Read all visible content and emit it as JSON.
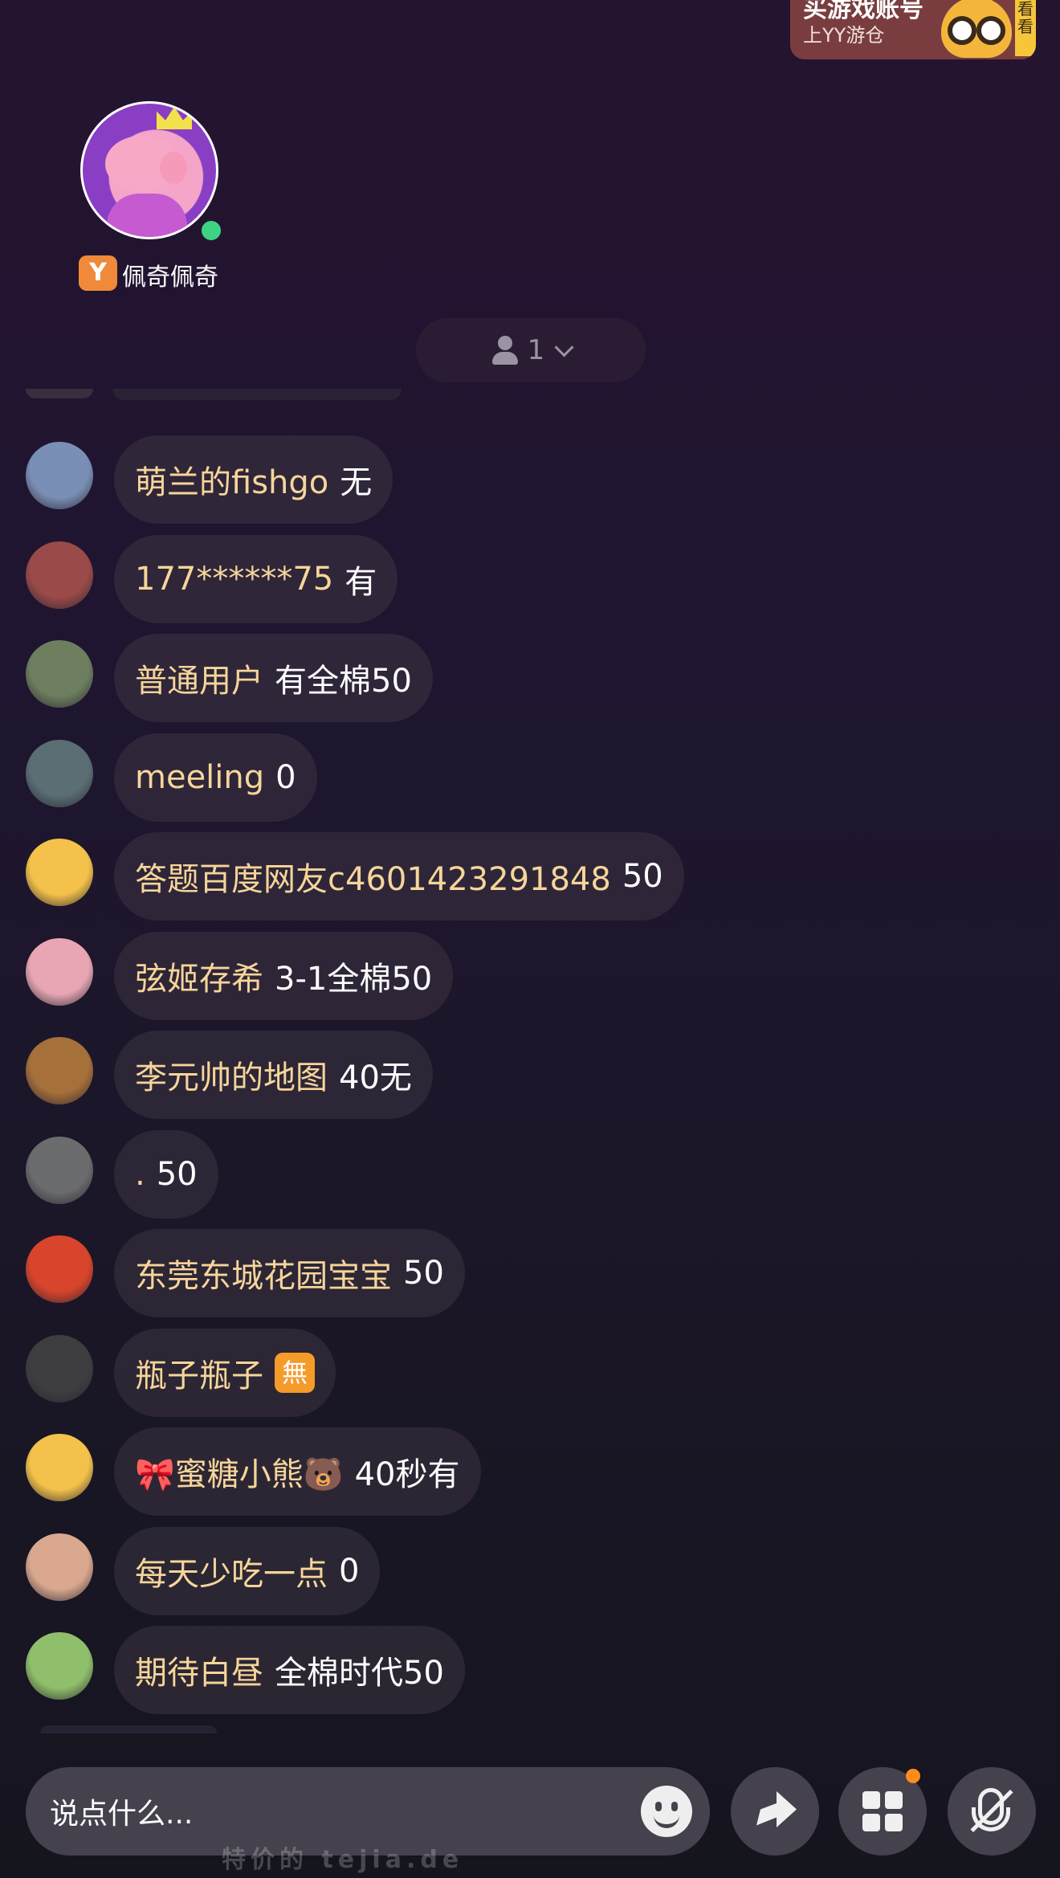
{
  "banner": {
    "line1": "买游戏账号",
    "line2": "上YY游仓",
    "tag": "看看"
  },
  "host": {
    "name": "佩奇佩奇",
    "badge": "Y"
  },
  "viewers": {
    "count": "1"
  },
  "chat": [
    {
      "user": "萌兰的fishgo",
      "msg": "无",
      "avatar_color": "#7a8fb5"
    },
    {
      "user": "177******75",
      "msg": "有",
      "avatar_color": "#9a4a48"
    },
    {
      "user": "普通用户",
      "msg": "有全棉50",
      "avatar_color": "#6d7f5e"
    },
    {
      "user": "meeling",
      "msg": "0",
      "avatar_color": "#5a6e73"
    },
    {
      "user": "答题百度网友c4601423291848",
      "msg": "50",
      "avatar_color": "#f4c24a"
    },
    {
      "user": "弦姬存希",
      "msg": "3-1全棉50",
      "avatar_color": "#e8a6b4"
    },
    {
      "user": "李元帅的地图",
      "msg": "40无",
      "avatar_color": "#a5703a"
    },
    {
      "user": ".",
      "msg": "50",
      "avatar_color": "#6a6c6e"
    },
    {
      "user": "东莞东城花园宝宝",
      "msg": "50",
      "avatar_color": "#d9452c"
    },
    {
      "user": "瓶子瓶子",
      "msg": "無",
      "avatar_color": "#3e3e40"
    },
    {
      "user": "🎀蜜糖小熊🐻",
      "msg": "40秒有",
      "avatar_color": "#f4c24a"
    },
    {
      "user": "每天少吃一点",
      "msg": "0",
      "avatar_color": "#d9a88e"
    },
    {
      "user": "期待白昼",
      "msg": "全棉时代50",
      "avatar_color": "#8fbf6a"
    }
  ],
  "input": {
    "placeholder": "说点什么..."
  },
  "watermark": "特价的 tejia.de"
}
